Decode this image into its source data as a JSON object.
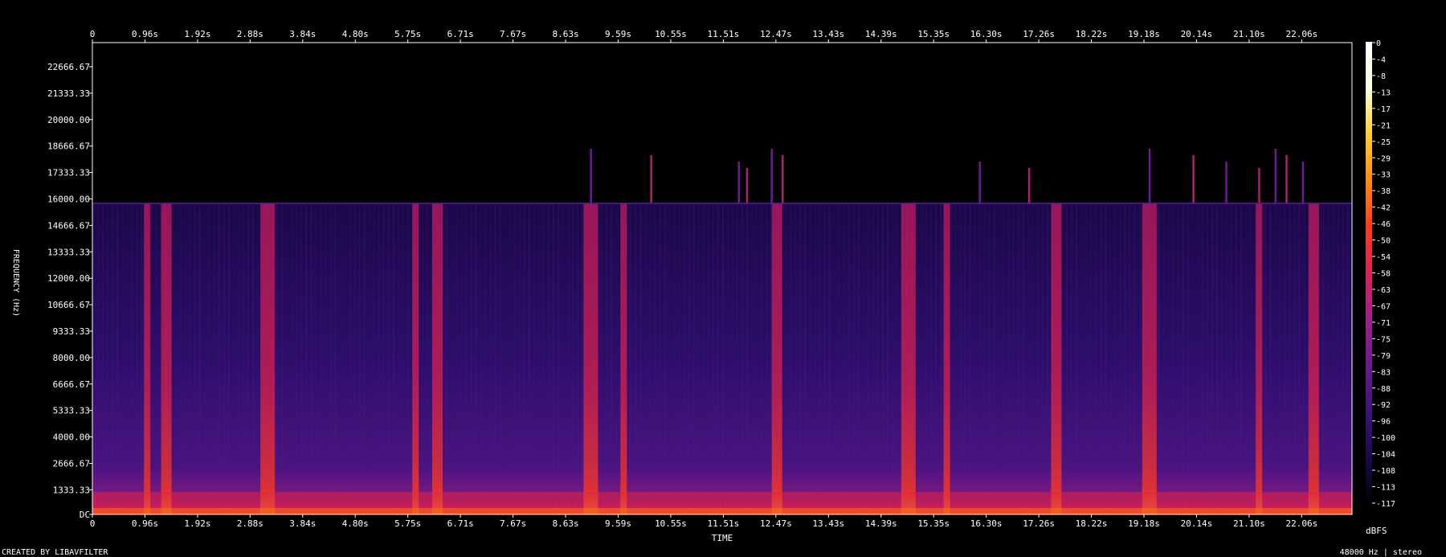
{
  "footer": {
    "left": "CREATED BY LIBAVFILTER",
    "right": "48000 Hz | stereo"
  },
  "chart_data": {
    "type": "heatmap",
    "title": "",
    "xlabel": "TIME",
    "ylabel": "FREQUENCY (Hz)",
    "x_ticks": [
      "0",
      "0.96s",
      "1.92s",
      "2.88s",
      "3.84s",
      "4.80s",
      "5.75s",
      "6.71s",
      "7.67s",
      "8.63s",
      "9.59s",
      "10.55s",
      "11.51s",
      "12.47s",
      "13.43s",
      "14.39s",
      "15.35s",
      "16.30s",
      "17.26s",
      "18.22s",
      "19.18s",
      "20.14s",
      "21.10s",
      "22.06s"
    ],
    "y_ticks": [
      "22666.67",
      "21333.33",
      "20000.00",
      "18666.67",
      "17333.33",
      "16000.00",
      "14666.67",
      "13333.33",
      "12000.00",
      "10666.67",
      "9333.33",
      "8000.00",
      "6666.67",
      "5333.33",
      "4000.00",
      "2666.67",
      "1333.33",
      "DC"
    ],
    "colorbar_label": "dBFS",
    "colorbar_ticks": [
      "0",
      "-4",
      "-8",
      "-13",
      "-17",
      "-21",
      "-25",
      "-29",
      "-33",
      "-38",
      "-42",
      "-46",
      "-50",
      "-54",
      "-58",
      "-63",
      "-67",
      "-71",
      "-75",
      "-79",
      "-83",
      "-88",
      "-92",
      "-96",
      "-100",
      "-104",
      "-108",
      "-113",
      "-117"
    ],
    "frequency_cutoff_hz": 16000,
    "colormap": [
      "#000000",
      "#1a0a4a",
      "#3c1477",
      "#6a1a8e",
      "#a0208a",
      "#d8225a",
      "#ff3a1c",
      "#ff8a10",
      "#ffd030",
      "#ffffe0",
      "#ffffff"
    ],
    "bursts_s": [
      1.0,
      1.35,
      3.2,
      5.9,
      6.3,
      9.1,
      9.7,
      12.5,
      14.9,
      15.6,
      17.6,
      19.3,
      21.3,
      22.3
    ],
    "spikes_s": [
      9.1,
      10.2,
      11.8,
      11.95,
      12.4,
      12.6,
      16.2,
      17.1,
      19.3,
      20.1,
      20.7,
      21.3,
      21.6,
      21.8,
      22.1
    ]
  }
}
